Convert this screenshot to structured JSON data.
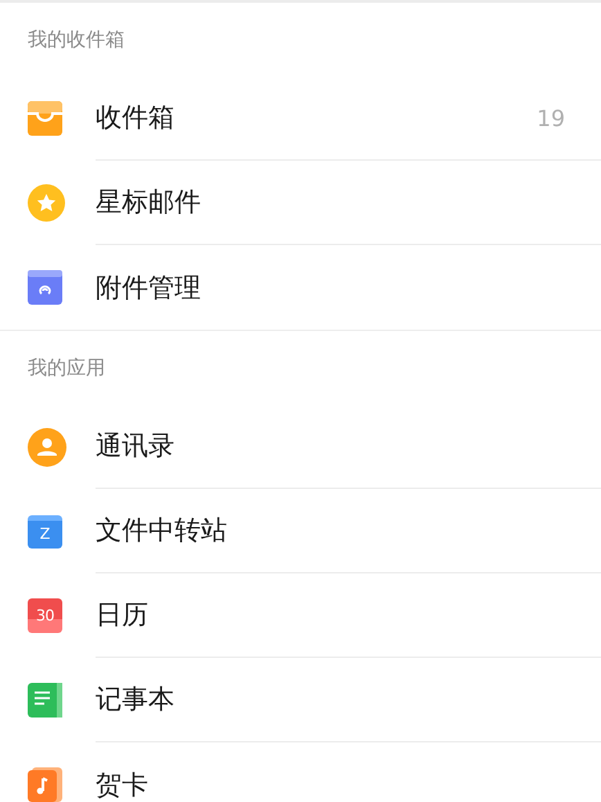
{
  "sections": [
    {
      "title": "我的收件箱",
      "items": [
        {
          "kind": "inbox",
          "label": "收件箱",
          "count": "19"
        },
        {
          "kind": "star",
          "label": "星标邮件"
        },
        {
          "kind": "attachment",
          "label": "附件管理"
        }
      ]
    },
    {
      "title": "我的应用",
      "items": [
        {
          "kind": "contacts",
          "label": "通讯录"
        },
        {
          "kind": "folder",
          "label": "文件中转站",
          "icon_text": "Z"
        },
        {
          "kind": "calendar",
          "label": "日历",
          "icon_text": "30"
        },
        {
          "kind": "notes",
          "label": "记事本"
        },
        {
          "kind": "card",
          "label": "贺卡"
        }
      ]
    }
  ]
}
